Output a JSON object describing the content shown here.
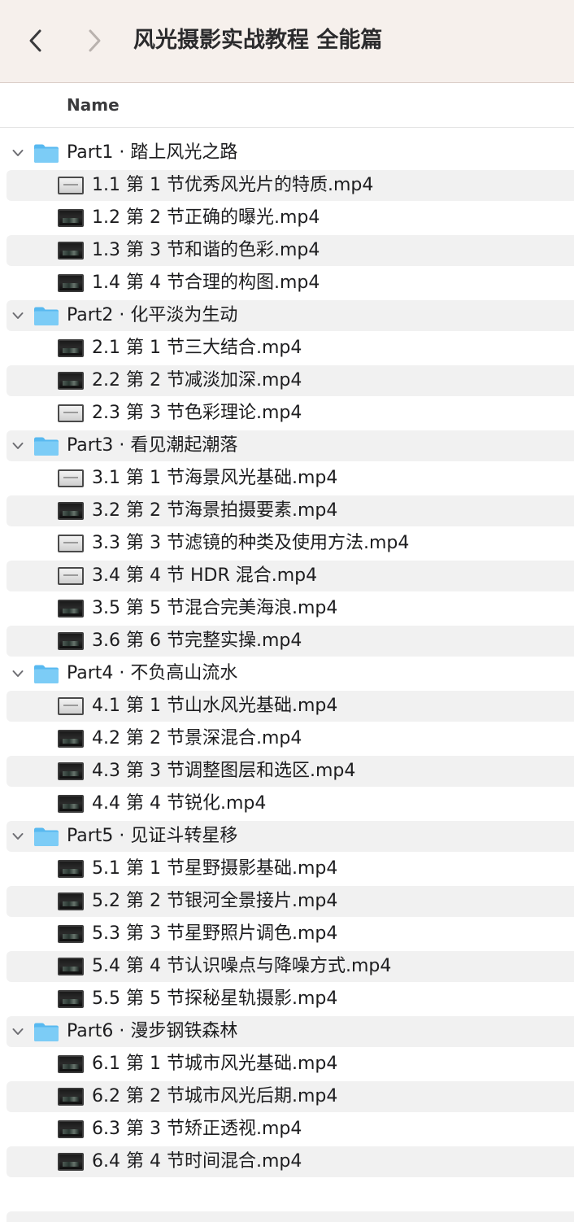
{
  "window": {
    "title": "风光摄影实战教程 全能篇",
    "back_icon": "chevron-left-icon",
    "forward_icon": "chevron-right-icon"
  },
  "columns": {
    "name": "Name"
  },
  "colors": {
    "titlebar_bg": "#f6f0ec",
    "stripe": "#f1f1f1",
    "folder_blue": "#58b9f0"
  },
  "groups": [
    {
      "name": "Part1 · 踏上风光之路",
      "expanded": true,
      "files": [
        {
          "name": "1.1 第 1 节优秀风光片的特质.mp4",
          "thumb": "light"
        },
        {
          "name": "1.2 第 2 节正确的曝光.mp4",
          "thumb": "dark"
        },
        {
          "name": "1.3 第 3 节和谐的色彩.mp4",
          "thumb": "dark"
        },
        {
          "name": "1.4 第 4 节合理的构图.mp4",
          "thumb": "dark"
        }
      ]
    },
    {
      "name": "Part2 · 化平淡为生动",
      "expanded": true,
      "files": [
        {
          "name": "2.1 第 1 节三大结合.mp4",
          "thumb": "dark"
        },
        {
          "name": "2.2 第 2 节减淡加深.mp4",
          "thumb": "dark"
        },
        {
          "name": "2.3 第 3 节色彩理论.mp4",
          "thumb": "light"
        }
      ]
    },
    {
      "name": "Part3 · 看见潮起潮落",
      "expanded": true,
      "files": [
        {
          "name": "3.1 第 1 节海景风光基础.mp4",
          "thumb": "light"
        },
        {
          "name": "3.2 第 2 节海景拍摄要素.mp4",
          "thumb": "dark"
        },
        {
          "name": "3.3 第 3 节滤镜的种类及使用方法.mp4",
          "thumb": "light"
        },
        {
          "name": "3.4 第 4 节 HDR 混合.mp4",
          "thumb": "light"
        },
        {
          "name": "3.5 第 5 节混合完美海浪.mp4",
          "thumb": "dark"
        },
        {
          "name": "3.6 第 6 节完整实操.mp4",
          "thumb": "dark"
        }
      ]
    },
    {
      "name": "Part4 · 不负高山流水",
      "expanded": true,
      "files": [
        {
          "name": "4.1 第 1 节山水风光基础.mp4",
          "thumb": "light"
        },
        {
          "name": "4.2 第 2 节景深混合.mp4",
          "thumb": "dark"
        },
        {
          "name": "4.3 第 3 节调整图层和选区.mp4",
          "thumb": "dark"
        },
        {
          "name": "4.4 第 4 节锐化.mp4",
          "thumb": "dark"
        }
      ]
    },
    {
      "name": "Part5 · 见证斗转星移",
      "expanded": true,
      "files": [
        {
          "name": "5.1 第 1 节星野摄影基础.mp4",
          "thumb": "dark"
        },
        {
          "name": "5.2 第 2 节银河全景接片.mp4",
          "thumb": "dark"
        },
        {
          "name": "5.3 第 3 节星野照片调色.mp4",
          "thumb": "dark"
        },
        {
          "name": "5.4 第 4 节认识噪点与降噪方式.mp4",
          "thumb": "dark"
        },
        {
          "name": "5.5 第 5 节探秘星轨摄影.mp4",
          "thumb": "dark"
        }
      ]
    },
    {
      "name": "Part6 · 漫步钢铁森林",
      "expanded": true,
      "files": [
        {
          "name": "6.1 第 1 节城市风光基础.mp4",
          "thumb": "dark"
        },
        {
          "name": "6.2 第 2 节城市风光后期.mp4",
          "thumb": "dark"
        },
        {
          "name": "6.3 第 3 节矫正透视.mp4",
          "thumb": "dark"
        },
        {
          "name": "6.4 第 4 节时间混合.mp4",
          "thumb": "dark"
        }
      ]
    }
  ]
}
